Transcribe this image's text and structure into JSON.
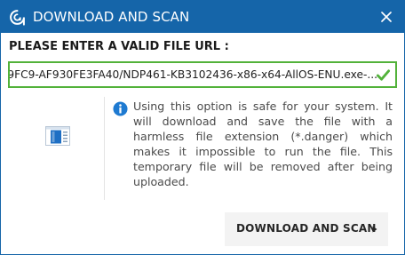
{
  "window": {
    "title": "DOWNLOAD AND SCAN",
    "logo_icon": "opswat-logo-icon",
    "close_icon": "close-icon"
  },
  "form": {
    "label": "PLEASE ENTER A VALID FILE URL :",
    "url_value": "...-9FC9-AF930FE3FA40/NDP461-KB3102436-x86-x64-AllOS-ENU.exe",
    "url_valid": true,
    "valid_icon": "checkmark-icon"
  },
  "info": {
    "icon": "info-icon",
    "file_icon": "document-icon",
    "message": "Using this option is safe for your system. It will download and save the file with a harmless file extension (*.danger) which makes it impossible to run the file. This temporary file will be removed after being uploaded."
  },
  "actions": {
    "scan_label": "DOWNLOAD AND SCAN",
    "scan_icon": "chevron-right-icon"
  },
  "colors": {
    "titlebar": "#1565a9",
    "valid_border": "#52b23a",
    "info_blue": "#1e7ad1",
    "button_bg": "#f3f3f3"
  }
}
